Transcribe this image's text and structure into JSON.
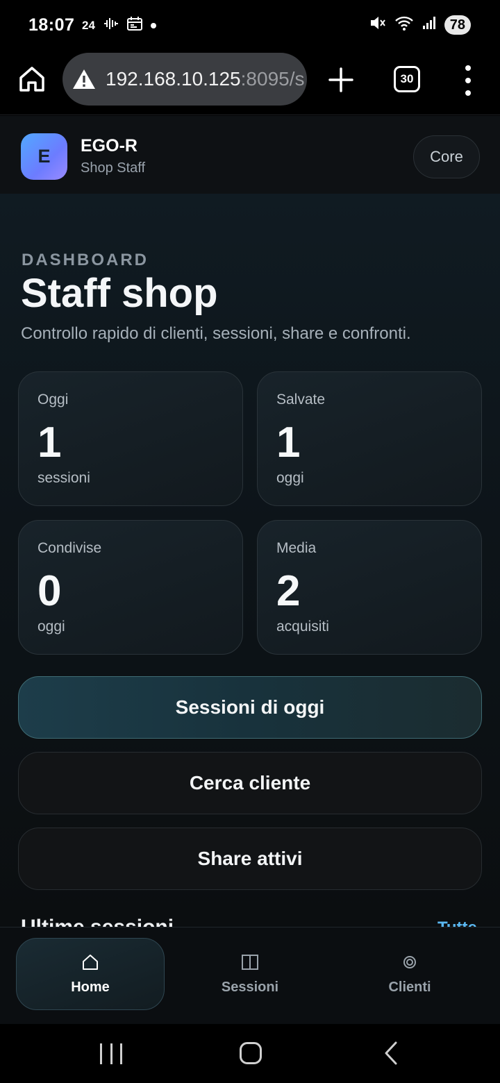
{
  "status_bar": {
    "time": "18:07",
    "left_icons": [
      "24-icon",
      "signal-wave-icon",
      "calendar-icon",
      "dot-icon"
    ],
    "right_icons": [
      "mute-icon",
      "wifi-icon",
      "cell-signal-icon"
    ],
    "battery": "78"
  },
  "browser": {
    "url_host": "192.168.10.125",
    "url_rest": ":8095/s",
    "tab_count": "30"
  },
  "app": {
    "logo_letter": "E",
    "title": "EGO-R",
    "subtitle": "Shop Staff",
    "badge": "Core"
  },
  "dashboard": {
    "eyebrow": "DASHBOARD",
    "title": "Staff shop",
    "description": "Controllo rapido di clienti, sessioni, share e confronti."
  },
  "stats": [
    {
      "label": "Oggi",
      "value": "1",
      "sub": "sessioni"
    },
    {
      "label": "Salvate",
      "value": "1",
      "sub": "oggi"
    },
    {
      "label": "Condivise",
      "value": "0",
      "sub": "oggi"
    },
    {
      "label": "Media",
      "value": "2",
      "sub": "acquisiti"
    }
  ],
  "actions": {
    "primary": "Sessioni di oggi",
    "search": "Cerca cliente",
    "shares": "Share attivi"
  },
  "peek": {
    "section_title": "Ultime sessioni",
    "link": "Tutte"
  },
  "nav": {
    "home": "Home",
    "sessions": "Sessioni",
    "clients": "Clienti"
  }
}
